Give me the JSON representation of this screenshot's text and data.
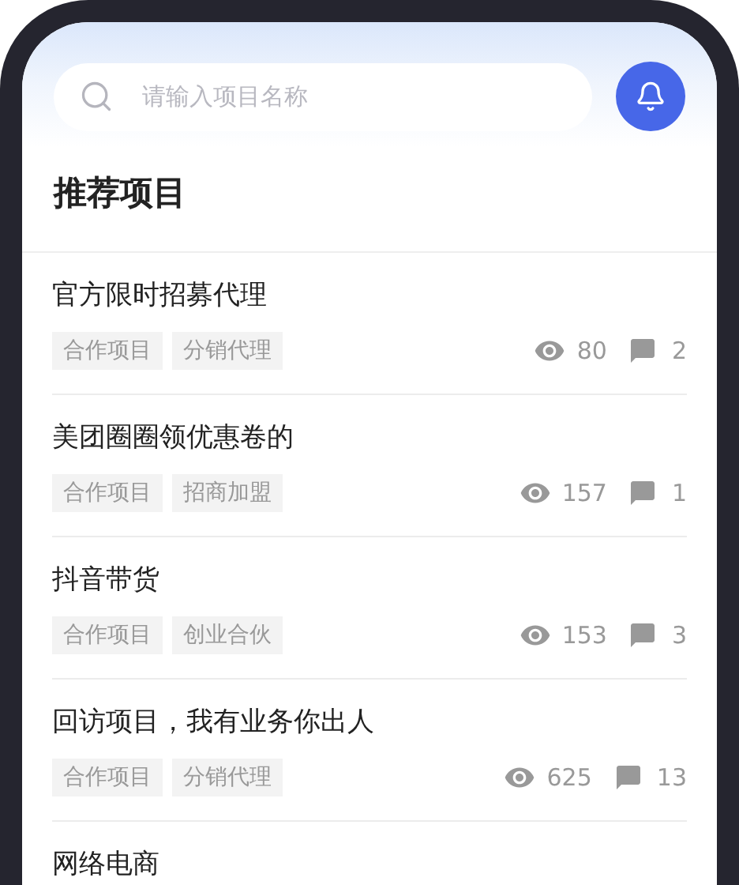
{
  "search": {
    "placeholder": "请输入项目名称"
  },
  "section_title": "推荐项目",
  "projects": [
    {
      "title": "官方限时招募代理",
      "tags": [
        "合作项目",
        "分销代理"
      ],
      "views": "80",
      "comments": "2"
    },
    {
      "title": "美团圈圈领优惠卷的",
      "tags": [
        "合作项目",
        "招商加盟"
      ],
      "views": "157",
      "comments": "1"
    },
    {
      "title": "抖音带货",
      "tags": [
        "合作项目",
        "创业合伙"
      ],
      "views": "153",
      "comments": "3"
    },
    {
      "title": "回访项目，我有业务你出人",
      "tags": [
        "合作项目",
        "分销代理"
      ],
      "views": "625",
      "comments": "13"
    },
    {
      "title": "网络电商"
    }
  ]
}
